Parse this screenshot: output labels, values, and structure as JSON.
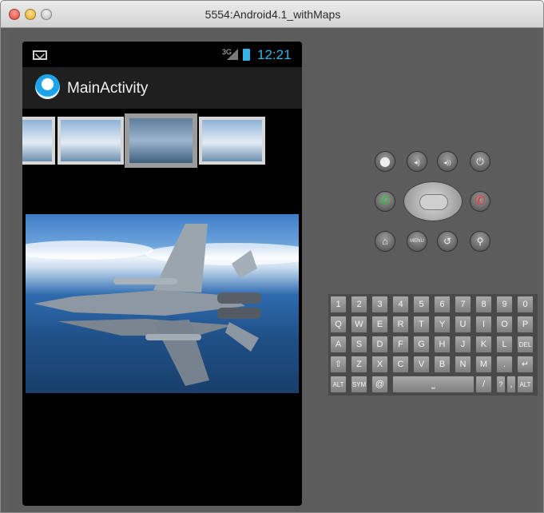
{
  "window": {
    "title": "5554:Android4.1_withMaps"
  },
  "statusbar": {
    "network": "3G",
    "time": "12:21"
  },
  "actionbar": {
    "title": "MainActivity"
  },
  "gallery": {
    "items": [
      {
        "label": "thumbnail-1"
      },
      {
        "label": "thumbnail-2"
      },
      {
        "label": "thumbnail-3"
      },
      {
        "label": "thumbnail-4"
      }
    ],
    "selected_index": 2
  },
  "controls": {
    "row1": [
      {
        "icon": "camera-icon",
        "glyph": "⬤"
      },
      {
        "icon": "volume-down-icon",
        "glyph": "◂)"
      },
      {
        "icon": "volume-up-icon",
        "glyph": "◂))"
      },
      {
        "icon": "power-icon",
        "glyph": "⏻"
      }
    ],
    "call_glyph": "✆",
    "endcall_glyph": "✆",
    "row3": [
      {
        "icon": "home-icon",
        "glyph": "⌂"
      },
      {
        "icon": "menu-icon",
        "glyph": "MENU"
      },
      {
        "icon": "back-icon",
        "glyph": "↺"
      },
      {
        "icon": "search-icon",
        "glyph": "⚲"
      }
    ]
  },
  "keyboard": {
    "rows": [
      [
        "1",
        "2",
        "3",
        "4",
        "5",
        "6",
        "7",
        "8",
        "9",
        "0"
      ],
      [
        "Q",
        "W",
        "E",
        "R",
        "T",
        "Y",
        "U",
        "I",
        "O",
        "P"
      ],
      [
        "A",
        "S",
        "D",
        "F",
        "G",
        "H",
        "J",
        "K",
        "L",
        "DEL"
      ],
      [
        "⇧",
        "Z",
        "X",
        "C",
        "V",
        "B",
        "N",
        "M",
        ".",
        "↵"
      ],
      [
        "ALT",
        "SYM",
        "@",
        "⎵",
        "/",
        "?",
        ",",
        "ALT"
      ]
    ]
  }
}
